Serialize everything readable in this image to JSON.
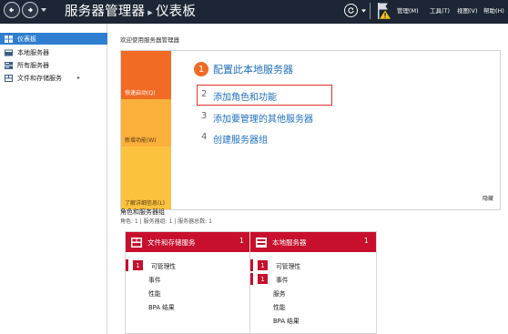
{
  "header": {
    "title": "服务器管理器",
    "separator": "▸",
    "page": "仪表板",
    "menus": [
      "管理(M)",
      "工具(T)",
      "视图(V)",
      "帮助(H)"
    ]
  },
  "sidebar": {
    "items": [
      {
        "label": "仪表板",
        "active": true
      },
      {
        "label": "本地服务器",
        "active": false
      },
      {
        "label": "所有服务器",
        "active": false
      },
      {
        "label": "文件和存储服务",
        "active": false
      }
    ],
    "expand_arrow": "▸"
  },
  "main": {
    "welcome": "欢迎使用服务器管理器",
    "quick_start": {
      "sections": [
        "快速启动(Q)",
        "新增功能(W)",
        "了解详细信息(L)"
      ],
      "step1": {
        "num": "1",
        "label": "配置此本地服务器"
      },
      "steps": [
        {
          "num": "2",
          "label": "添加角色和功能"
        },
        {
          "num": "3",
          "label": "添加要管理的其他服务器"
        },
        {
          "num": "4",
          "label": "创建服务器组"
        }
      ],
      "hide": "隐藏"
    },
    "roles": {
      "title": "角色和服务器组",
      "subtitle": "角色: 1 | 服务器组: 1 | 服务器总数: 1"
    },
    "tiles": [
      {
        "name": "文件和存储服务",
        "count": "1",
        "rows": [
          {
            "badge": "1",
            "label": "可管理性"
          },
          {
            "badge": "",
            "label": "事件"
          },
          {
            "badge": "",
            "label": "性能"
          },
          {
            "badge": "",
            "label": "BPA 结果"
          }
        ]
      },
      {
        "name": "本地服务器",
        "count": "1",
        "rows": [
          {
            "badge": "1",
            "label": "可管理性"
          },
          {
            "badge": "1",
            "label": "事件"
          },
          {
            "badge": "",
            "label": "服务"
          },
          {
            "badge": "",
            "label": "性能"
          },
          {
            "badge": "",
            "label": "BPA 结果"
          }
        ]
      }
    ]
  },
  "colors": {
    "header_bg": "#1d2634",
    "accent_blue": "#2f7fd1",
    "orange": "#f16b24",
    "amber": "#fbb03b",
    "yellow": "#fbc23f",
    "tile_red": "#c8102e",
    "link_blue": "#1f6fbf",
    "highlight_red": "#e0312a"
  },
  "icons": [
    "back-arrow-icon",
    "forward-arrow-icon",
    "refresh-icon",
    "warning-flag-icon",
    "dashboard-icon",
    "server-icon",
    "servers-icon",
    "storage-icon"
  ]
}
